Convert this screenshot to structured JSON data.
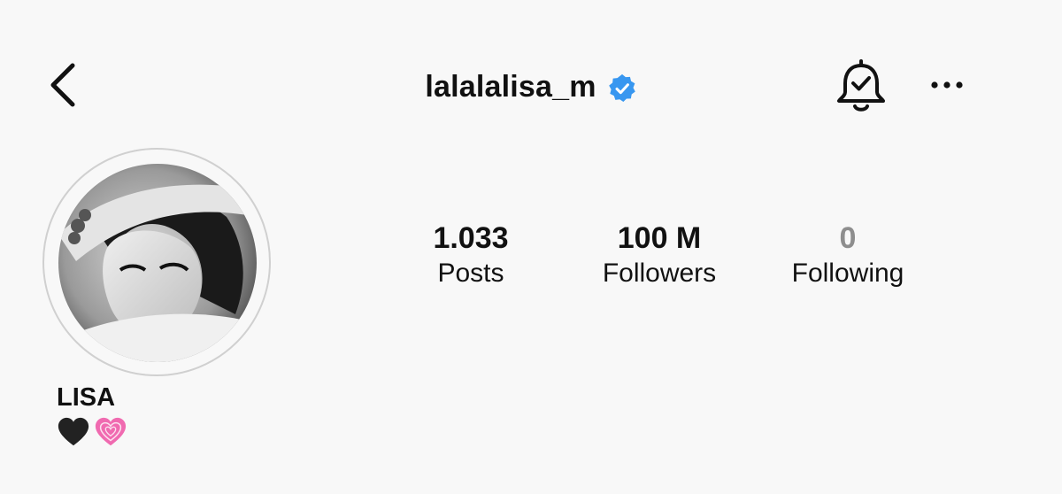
{
  "header": {
    "username": "lalalalisa_m",
    "icons": {
      "back": "chevron-left-icon",
      "verified": "verified-badge-icon",
      "notifications": "bell-check-icon",
      "more": "more-horizontal-icon"
    },
    "verified_color": "#3897f0"
  },
  "profile": {
    "display_name": "LISA",
    "bio_icons": [
      "black-heart-icon",
      "pink-heart-icon"
    ],
    "stats": {
      "posts": {
        "value": "1.033",
        "label": "Posts"
      },
      "followers": {
        "value": "100 M",
        "label": "Followers"
      },
      "following": {
        "value": "0",
        "label": "Following"
      }
    }
  }
}
